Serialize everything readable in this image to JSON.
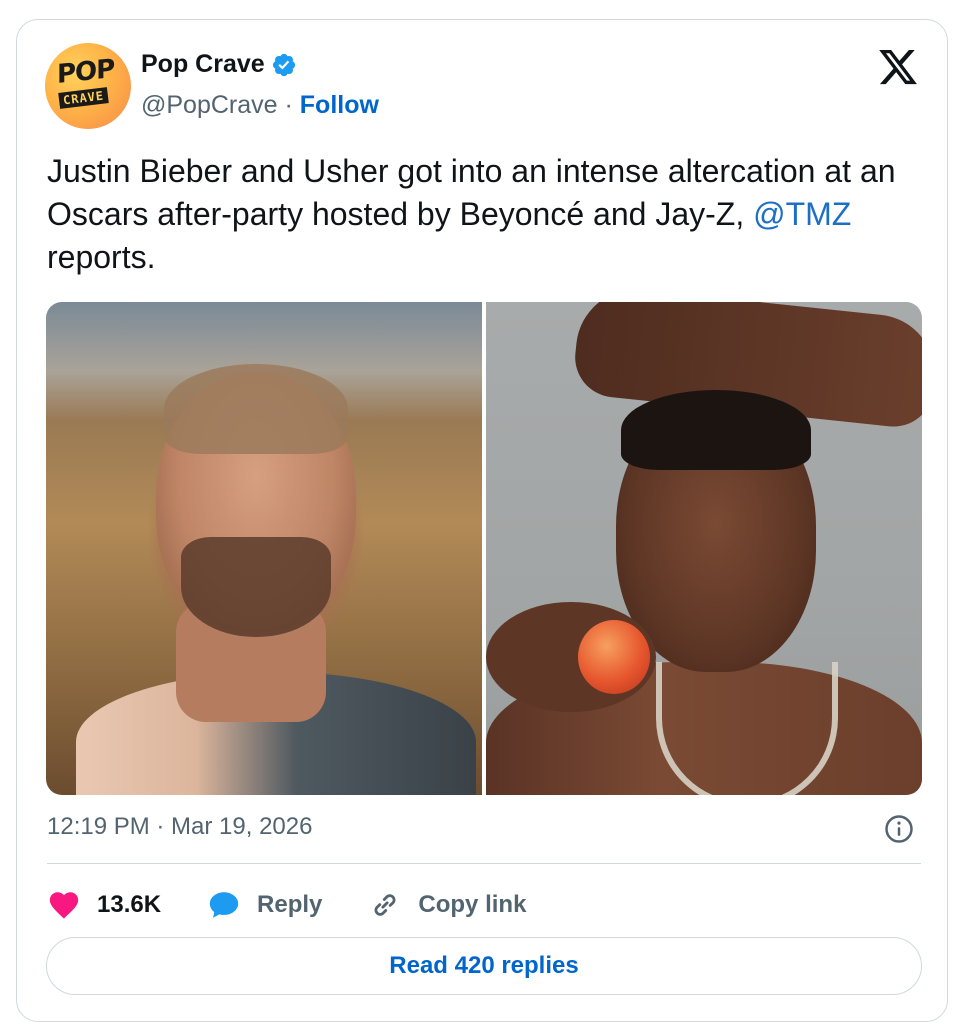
{
  "author": {
    "avatar_text_top": "POP",
    "avatar_text_bottom": "CRAVE",
    "name": "Pop Crave",
    "handle": "@PopCrave",
    "separator": " · ",
    "follow_label": "Follow",
    "verified_icon": "verified-badge-icon"
  },
  "brand_icon": "x-logo-icon",
  "tweet": {
    "text_main": "Justin Bieber and Usher got into an intense altercation at an Oscars after-party hosted by Beyoncé and Jay-Z, ",
    "mention": "@TMZ",
    "text_end": " reports."
  },
  "media": {
    "images": [
      "photo-left",
      "photo-right"
    ]
  },
  "meta": {
    "timestamp": "12:19 PM · Mar 19, 2026",
    "info_icon": "info-icon"
  },
  "actions": {
    "likes": "13.6K",
    "reply_label": "Reply",
    "copy_label": "Copy link"
  },
  "read_replies_label": "Read 420 replies",
  "colors": {
    "link": "#0066cc",
    "mention": "#1d6fc4",
    "like": "#f91880",
    "reply": "#1d9bf0",
    "muted": "#536471",
    "border": "#cfd9de"
  }
}
